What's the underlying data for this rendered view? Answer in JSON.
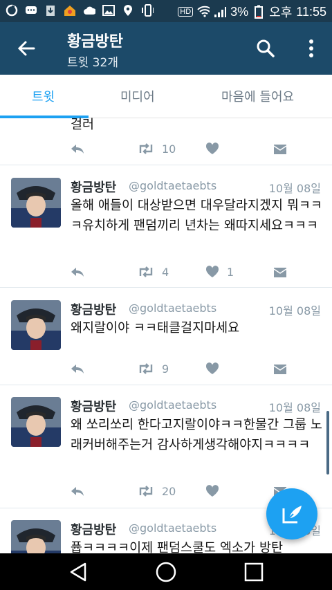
{
  "statusbar": {
    "battery": "3%",
    "ampm": "오후",
    "time": "11:55",
    "hd_label": "HD"
  },
  "header": {
    "title": "황금방탄",
    "subtitle": "트윗 32개"
  },
  "tabs": [
    {
      "label": "트윗",
      "active": true
    },
    {
      "label": "미디어",
      "active": false
    },
    {
      "label": "마음에 들어요",
      "active": false
    }
  ],
  "partial_tweet": {
    "text_tail": "걸러",
    "retweets": "10"
  },
  "tweets": [
    {
      "name": "황금방탄",
      "handle": "@goldtaetaebts",
      "date": "10월 08일",
      "text": "올해 애들이 대상받으면 대우달라지겠지 뭐ㅋㅋㅋ유치하게 팬덤끼리 년차는 왜따지세요ㅋㅋㅋ",
      "retweets": "4",
      "likes": "1"
    },
    {
      "name": "황금방탄",
      "handle": "@goldtaetaebts",
      "date": "10월 08일",
      "text": "왜지랄이야 ㅋㅋ태클걸지마세요",
      "retweets": "9",
      "likes": ""
    },
    {
      "name": "황금방탄",
      "handle": "@goldtaetaebts",
      "date": "10월 08일",
      "text": "왜 쏘리쏘리 한다고지랄이야ㅋㅋ한물간 그룹 노래커버해주는거 감사하게생각해야지ㅋㅋㅋㅋ",
      "retweets": "20",
      "likes": ""
    },
    {
      "name": "황금방탄",
      "handle": "@goldtaetaebts",
      "date": "10월 08일",
      "text": "퓹ㅋㅋㅋㅋ이제 팬덤스쿨도 엑소가 방탄",
      "retweets": "",
      "likes": ""
    }
  ],
  "colors": {
    "appbar": "#1c4a69",
    "statusbar": "#1b3a4f",
    "accent": "#1da1f2",
    "icon_gray": "#8899a6"
  }
}
